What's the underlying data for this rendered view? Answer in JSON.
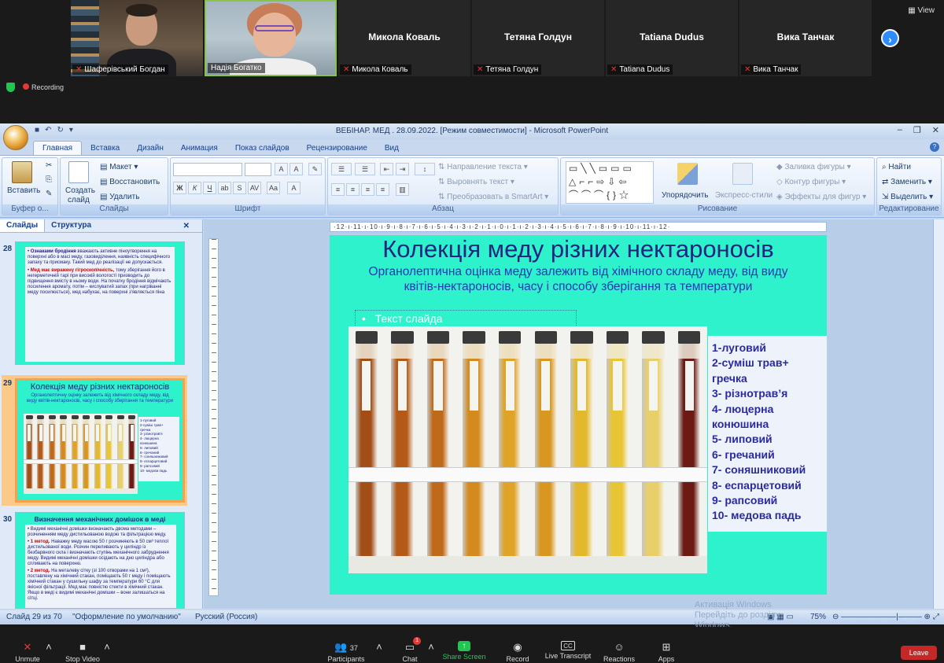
{
  "zoom": {
    "view_label": "View",
    "recording_label": "Recording",
    "participants_tiles": [
      {
        "name": "Шаферівський Богдан",
        "video": true
      },
      {
        "name": "Надія Богатко",
        "video": true
      },
      {
        "name": "Микола Коваль",
        "video": false
      },
      {
        "name": "Тетяна Голдун",
        "video": false
      },
      {
        "name": "Tatiana Dudus",
        "video": false
      },
      {
        "name": "Вика Танчак",
        "video": false
      }
    ],
    "toolbar": {
      "unmute": "Unmute",
      "stop_video": "Stop Video",
      "participants": "Participants",
      "participants_count": "37",
      "chat": "Chat",
      "chat_badge": "1",
      "share_screen": "Share Screen",
      "record": "Record",
      "live_transcript": "Live Transcript",
      "reactions": "Reactions",
      "apps": "Apps",
      "leave": "Leave"
    },
    "activate_windows": [
      "Активація Windows",
      "Перейдіть до розділу",
      "Windows."
    ]
  },
  "ppt": {
    "window_title": "ВЕБІНАР. МЕД . 28.09.2022. [Режим совместимости] - Microsoft PowerPoint",
    "tabs": [
      "Главная",
      "Вставка",
      "Дизайн",
      "Анимация",
      "Показ слайдов",
      "Рецензирование",
      "Вид"
    ],
    "active_tab": "Главная",
    "ribbon": {
      "clipboard": {
        "paste": "Вставить",
        "label": "Буфер о..."
      },
      "slides": {
        "create": "Создать",
        "create2": "слайд",
        "layout": "Макет",
        "reset": "Восстановить",
        "delete": "Удалить",
        "label": "Слайды"
      },
      "font": {
        "label": "Шрифт"
      },
      "paragraph": {
        "text_direction": "Направление текста",
        "align_text": "Выровнять текст",
        "smartart": "Преобразовать в SmartArt",
        "label": "Абзац"
      },
      "drawing": {
        "arrange": "Упорядочить",
        "quick_styles": "Экспресс-стили",
        "shape_fill": "Заливка фигуры",
        "shape_outline": "Контур фигуры",
        "shape_effects": "Эффекты для фигур",
        "label": "Рисование"
      },
      "editing": {
        "find": "Найти",
        "replace": "Заменить",
        "select": "Выделить",
        "label": "Редактирование"
      }
    },
    "panel": {
      "tab_slides": "Слайды",
      "tab_outline": "Структура",
      "thumbs": [
        {
          "num": "28",
          "bullet1_title": "Ознаками бродіння",
          "bullet1": "вважають активне піноутворення на поверхні або в масі меду, газовиділення, наявність специфічного запаху та присмаку. Такий мед до реалізації не допускається.",
          "bullet2_title": "Мед має виражену гігроскопічність,",
          "bullet2": "тому зберігання його в негерметичній тарі при високій вологості призводить до підвищення вмісту в ньому води. На початку бродіння відмічають посилення аромату, потім – кислуватий запах (при нагріванні меду посилюється), мед набухає, на поверхні з'являється піна"
        },
        {
          "num": "29",
          "title": "Колекція меду різних нектароносів",
          "sub": "Органолептичну оцінку залежить від хімічного складу меду, від виду квітів-нектароносів, часу і способу зберігання та температури"
        },
        {
          "num": "30",
          "title": "Визначення механічних домішок в меді",
          "b1": "Видимі механічні домішки визначають двома методами – розчиненням меду дистильованою водою та фільтрацією меду.",
          "b2_title": "1 метод.",
          "b2": "Наважку меду масою 50 г розчиняють в 50 см³ теплої дистильованої води. Розчин переливають у циліндр із безбарвного скла і визначають ступінь механічного забруднення меду. Видимі механічні домішки осідають на дно циліндра або спливають на поверхню.",
          "b3_title": "2 метод.",
          "b3": "На металеву сітку (зі 100 отворами на 1 см²), поставлену на хімічний стакан, поміщають 50 г меду і поміщають хімічний стакан у сушильну шафу за температури 60 °С для якісної фільтрації. Мед має повністю стекти в хімічний стакан. Якщо в меді є видимі механічні домішки – вони залишаться на сітці."
        }
      ]
    },
    "slide": {
      "title": "Колекція меду різних  нектароносів",
      "subtitle": "Органолептична оцінка меду  залежить від хімічного складу меду, від виду квітів-нектароносів, часу і способу зберігання та температури",
      "placeholder": "Текст слайда",
      "placeholder_bullet": "•",
      "list": [
        "1-луговий",
        "2-суміш трав+",
        "гречка",
        "3- різнотрав’я",
        "4- люцерна",
        "конюшина",
        "5- липовий",
        "6- гречаний",
        "7- соняшниковий",
        "8- еспарцетовий",
        "9- рапсовий",
        "10- медова падь"
      ],
      "tube_colors": [
        "#a24e17",
        "#b45a18",
        "#bf6a1a",
        "#d58a1e",
        "#dfa327",
        "#d8971f",
        "#e3b82c",
        "#e8c534",
        "#e9cf6b",
        "#6b1a14"
      ]
    },
    "ruler_text": "·12·ı·11·ı·10·ı·9·ı·8·ı·7·ı·6·ı·5·ı·4·ı·3·ı·2·ı·1·ı·0·ı·1·ı·2·ı·3·ı·4·ı·5·ı·6·ı·7·ı·8·ı·9·ı·10·ı·11·ı·12·",
    "status": {
      "slide_of": "Слайд 29 из 70",
      "theme": "\"Оформление по умолчанию\"",
      "lang": "Русский (Россия)",
      "zoom": "75%"
    }
  }
}
